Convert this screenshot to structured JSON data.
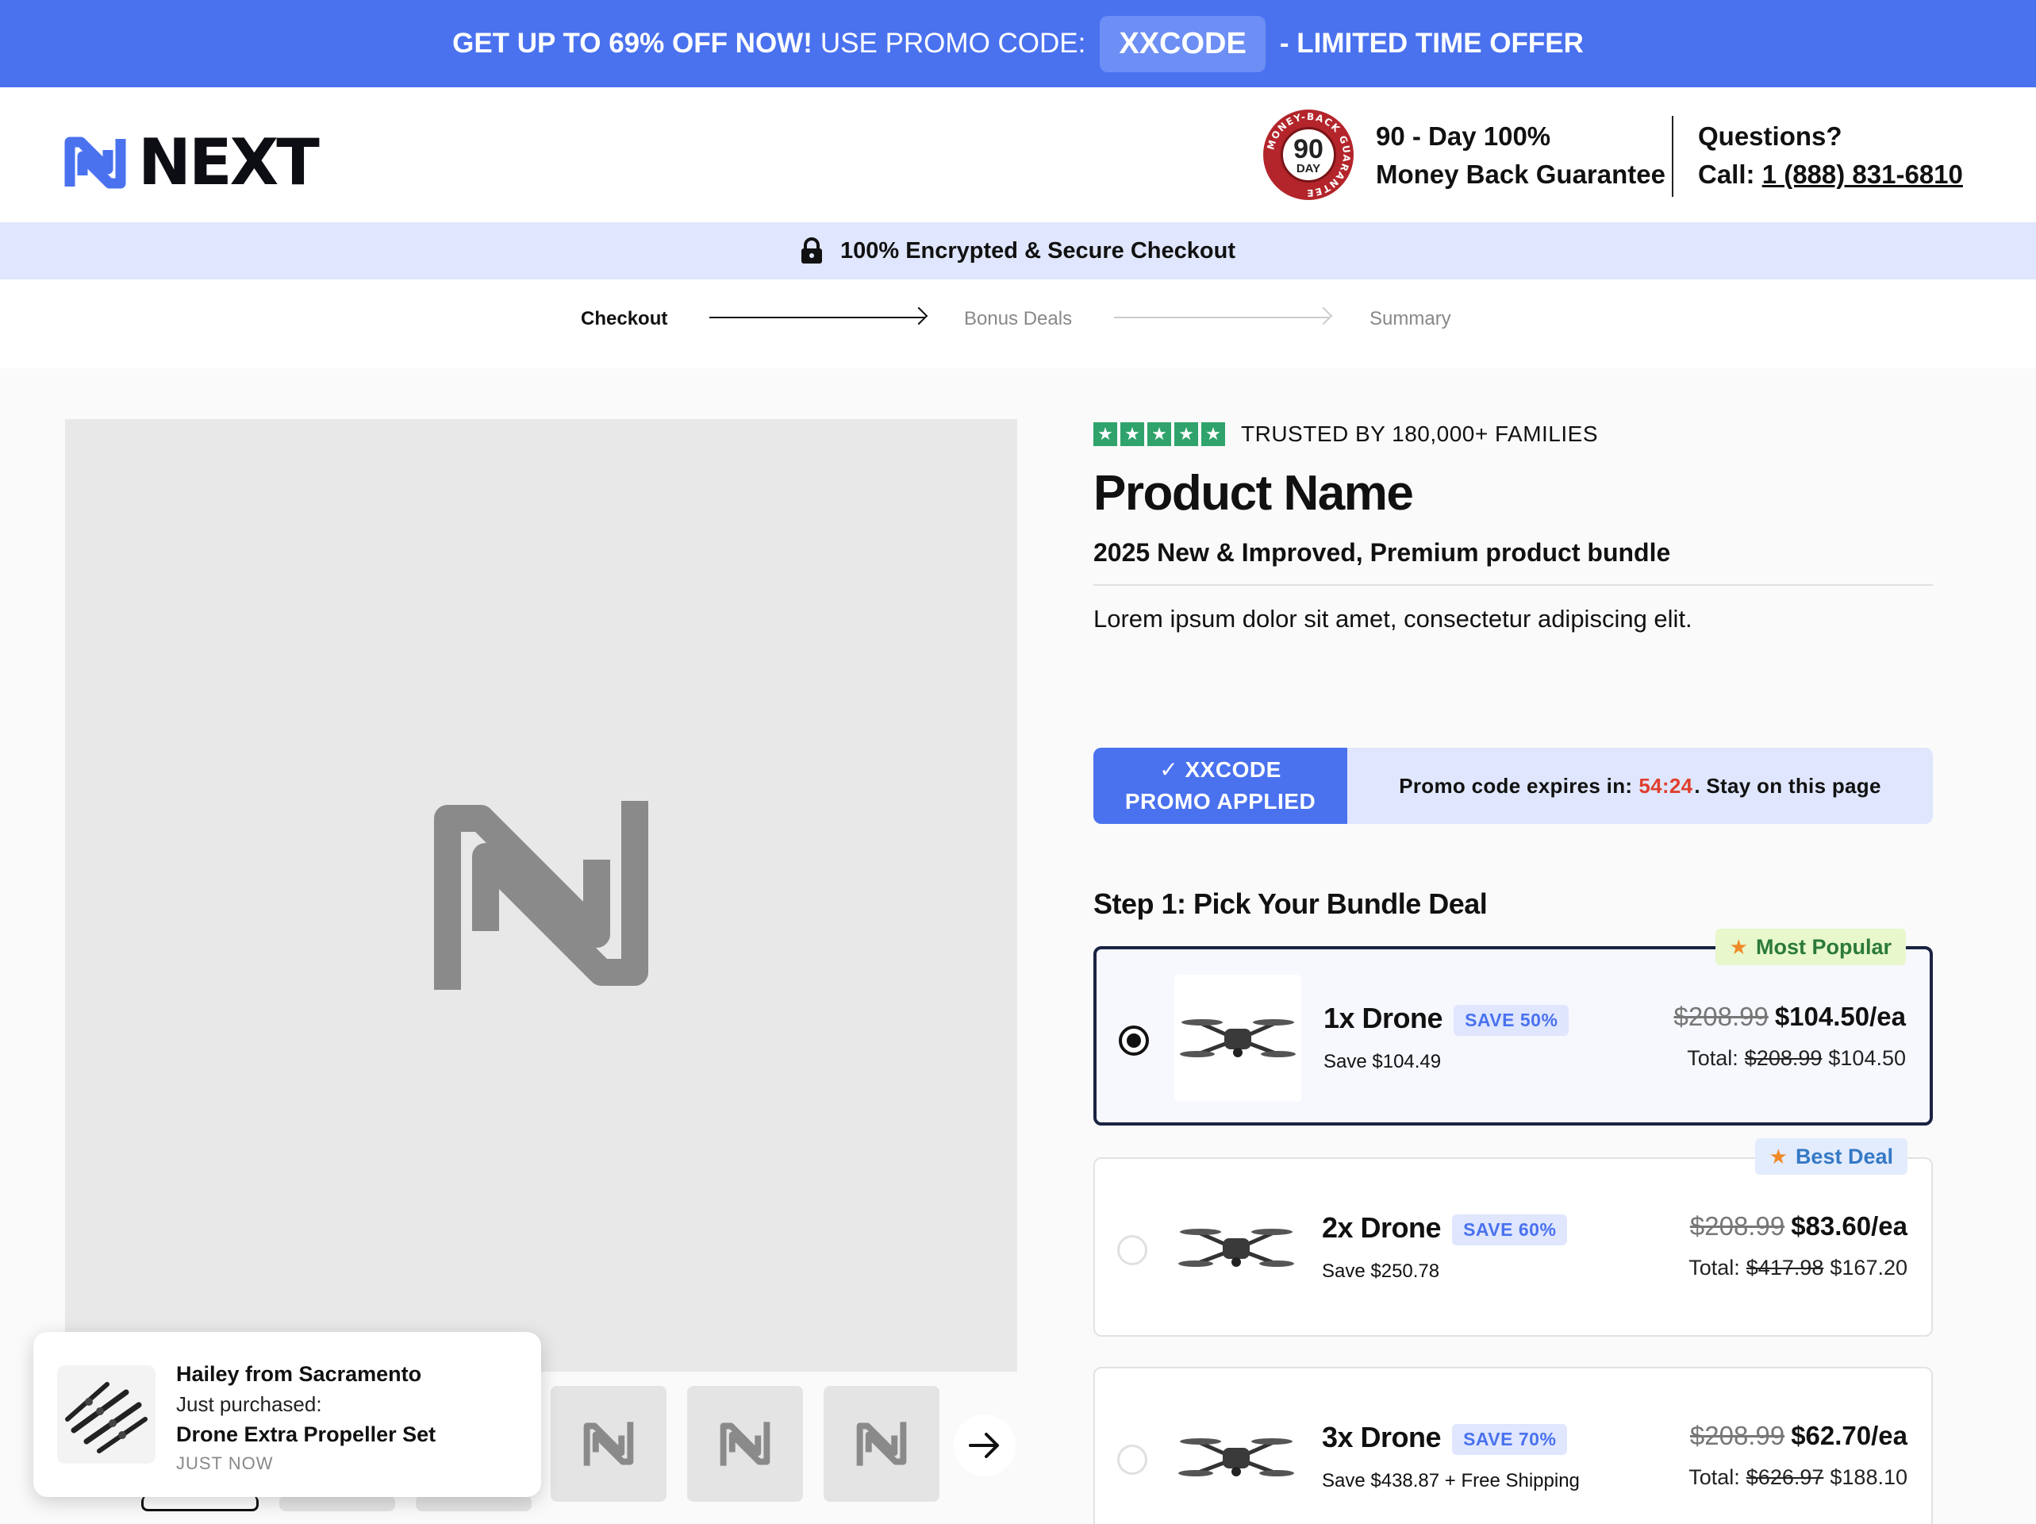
{
  "promo_bar": {
    "lead": "GET UP TO 69% OFF NOW!",
    "use_code": "USE PROMO CODE:",
    "code": "XXCODE",
    "tail": "- LIMITED TIME OFFER",
    "color": "#4a72ef"
  },
  "header": {
    "logo_text": "NEXT",
    "seal": {
      "ring_text": "MONEY-BACK GUARANTEE",
      "number": "90",
      "unit": "DAY"
    },
    "guarantee_line1": "90 - Day 100%",
    "guarantee_line2": "Money Back Guarantee",
    "questions_label": "Questions?",
    "call_label": "Call:",
    "phone": "1 (888) 831-6810"
  },
  "secure_bar": {
    "text": "100% Encrypted & Secure Checkout",
    "icon": "lock-icon"
  },
  "steps": [
    {
      "label": "Checkout",
      "state": "active"
    },
    {
      "label": "Bonus Deals",
      "state": "upcoming"
    },
    {
      "label": "Summary",
      "state": "upcoming"
    }
  ],
  "gallery": {
    "main_image": "placeholder-logo-image",
    "thumb_icons": [
      "placeholder-logo-icon",
      "placeholder-logo-icon",
      "placeholder-logo-icon"
    ],
    "next_icon": "arrow-right-icon"
  },
  "toast": {
    "name": "Hailey from Sacramento",
    "action": "Just purchased:",
    "product": "Drone Extra Propeller Set",
    "time": "JUST NOW"
  },
  "product": {
    "rating_stars": 5,
    "trust_text": "TRUSTED BY 180,000+ FAMILIES",
    "name": "Product Name",
    "tagline": "2025 New & Improved, Premium product bundle",
    "description": "Lorem ipsum dolor sit amet, consectetur adipiscing elit."
  },
  "promo_applied": {
    "line1": "✓ XXCODE",
    "line2": "PROMO APPLIED",
    "expires_label": "Promo code expires in:",
    "time": "54:24",
    "suffix": ". Stay on this page",
    "time_color": "#e03e2d"
  },
  "bundles": {
    "step_title": "Step 1: Pick Your Bundle Deal",
    "items": [
      {
        "title": "1x Drone",
        "badge": "SAVE 50%",
        "save": "Save $104.49",
        "old_price": "$208.99",
        "price": "$104.50/ea",
        "total_label": "Total:",
        "total_old": "$208.99",
        "total": "$104.50",
        "ribbon": "Most Popular",
        "selected": true
      },
      {
        "title": "2x Drone",
        "badge": "SAVE 60%",
        "save": "Save $250.78",
        "old_price": "$208.99",
        "price": "$83.60/ea",
        "total_label": "Total:",
        "total_old": "$417.98",
        "total": "$167.20",
        "ribbon": "Best Deal",
        "selected": false
      },
      {
        "title": "3x Drone",
        "badge": "SAVE 70%",
        "save": "Save $438.87 + Free Shipping",
        "old_price": "$208.99",
        "price": "$62.70/ea",
        "total_label": "Total:",
        "total_old": "$626.97",
        "total": "$188.10",
        "ribbon": "",
        "selected": false
      }
    ]
  }
}
